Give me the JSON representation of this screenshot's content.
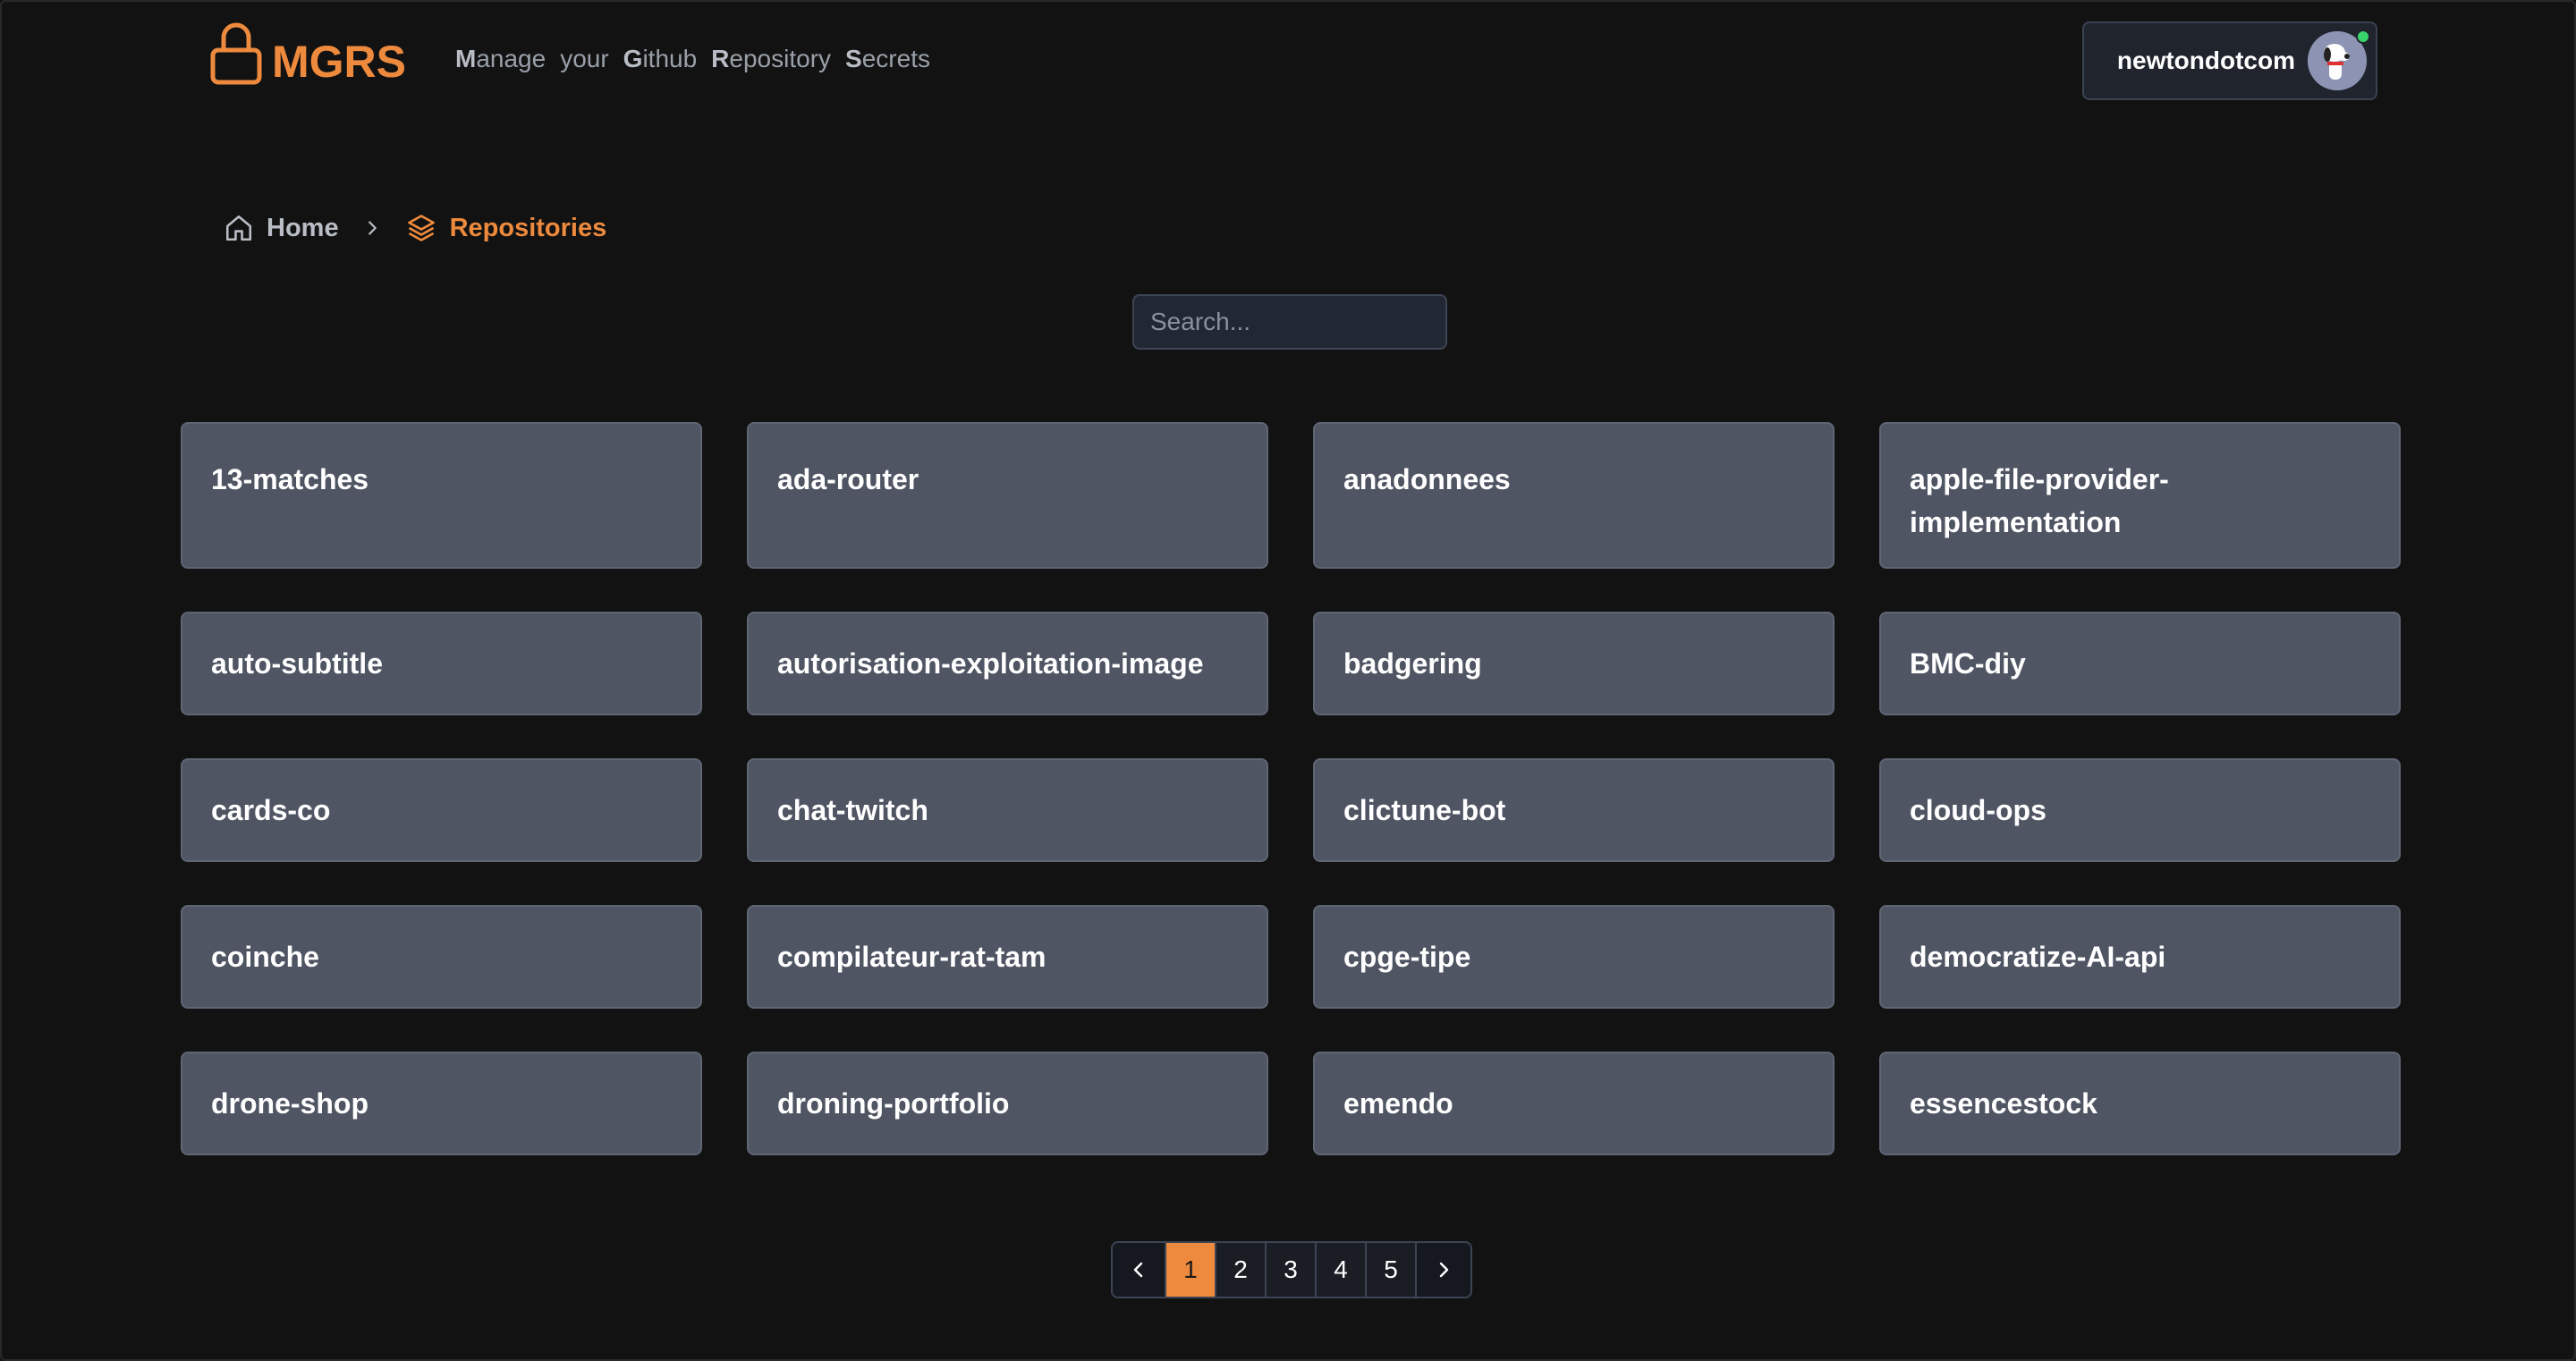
{
  "header": {
    "logo_text": "MGRS",
    "tagline": [
      {
        "cap": "M",
        "rest": "anage"
      },
      {
        "cap": "",
        "rest": "your"
      },
      {
        "cap": "G",
        "rest": "ithub"
      },
      {
        "cap": "R",
        "rest": "epository"
      },
      {
        "cap": "S",
        "rest": "ecrets"
      }
    ],
    "user": {
      "name": "newtondotcom",
      "online": true
    }
  },
  "breadcrumb": {
    "home_label": "Home",
    "current_label": "Repositories"
  },
  "search": {
    "placeholder": "Search...",
    "value": ""
  },
  "repositories": [
    "13-matches",
    "ada-router",
    "anadonnees",
    "apple-file-provider-implementation",
    "auto-subtitle",
    "autorisation-exploitation-image",
    "badgering",
    "BMC-diy",
    "cards-co",
    "chat-twitch",
    "clictune-bot",
    "cloud-ops",
    "coinche",
    "compilateur-rat-tam",
    "cpge-tipe",
    "democratize-AI-api",
    "drone-shop",
    "droning-portfolio",
    "emendo",
    "essencestock"
  ],
  "pagination": {
    "pages": [
      "1",
      "2",
      "3",
      "4",
      "5"
    ],
    "current": "1"
  },
  "colors": {
    "accent": "#ee8a3d",
    "background": "#121212",
    "card": "#4f5563",
    "online": "#39d36b"
  }
}
